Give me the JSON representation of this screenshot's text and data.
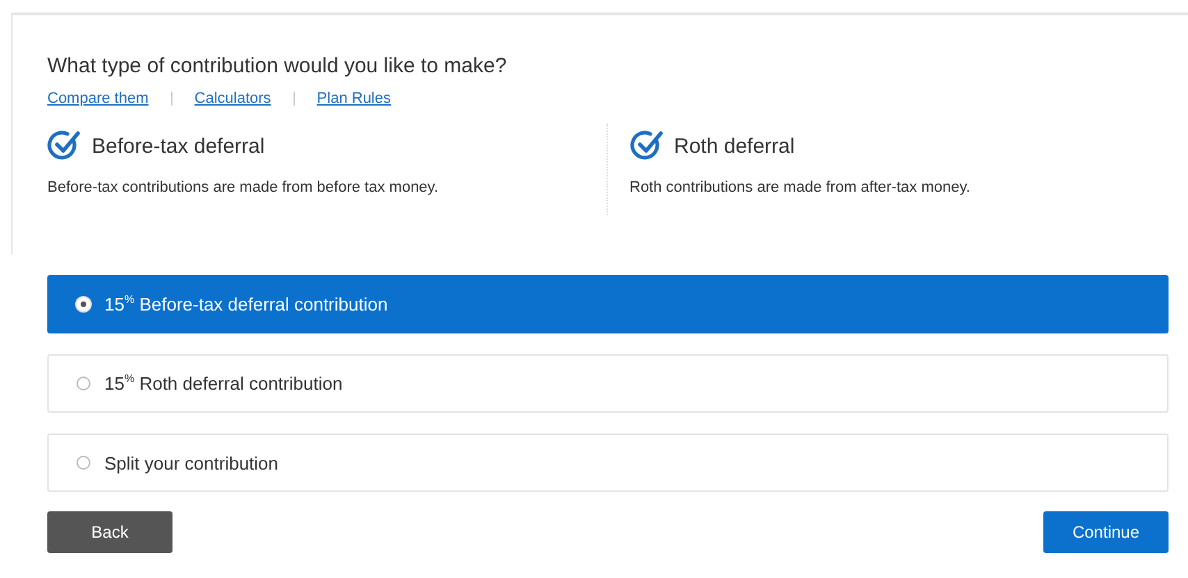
{
  "question": "What type of contribution would you like to make?",
  "links": [
    "Compare them",
    "Calculators",
    "Plan Rules"
  ],
  "types": [
    {
      "title": "Before-tax deferral",
      "description": "Before-tax contributions are made from before tax money."
    },
    {
      "title": "Roth deferral",
      "description": "Roth contributions are made from after-tax money."
    }
  ],
  "options": [
    {
      "label": "15$^{%}$ Before-tax deferral contribution",
      "selected": true
    },
    {
      "label": "15$^{%}$ Roth deferral contribution",
      "selected": false
    },
    {
      "label": "Split your contribution",
      "selected": false
    }
  ],
  "buttons": {
    "back": "Back",
    "continue": "Continue"
  }
}
